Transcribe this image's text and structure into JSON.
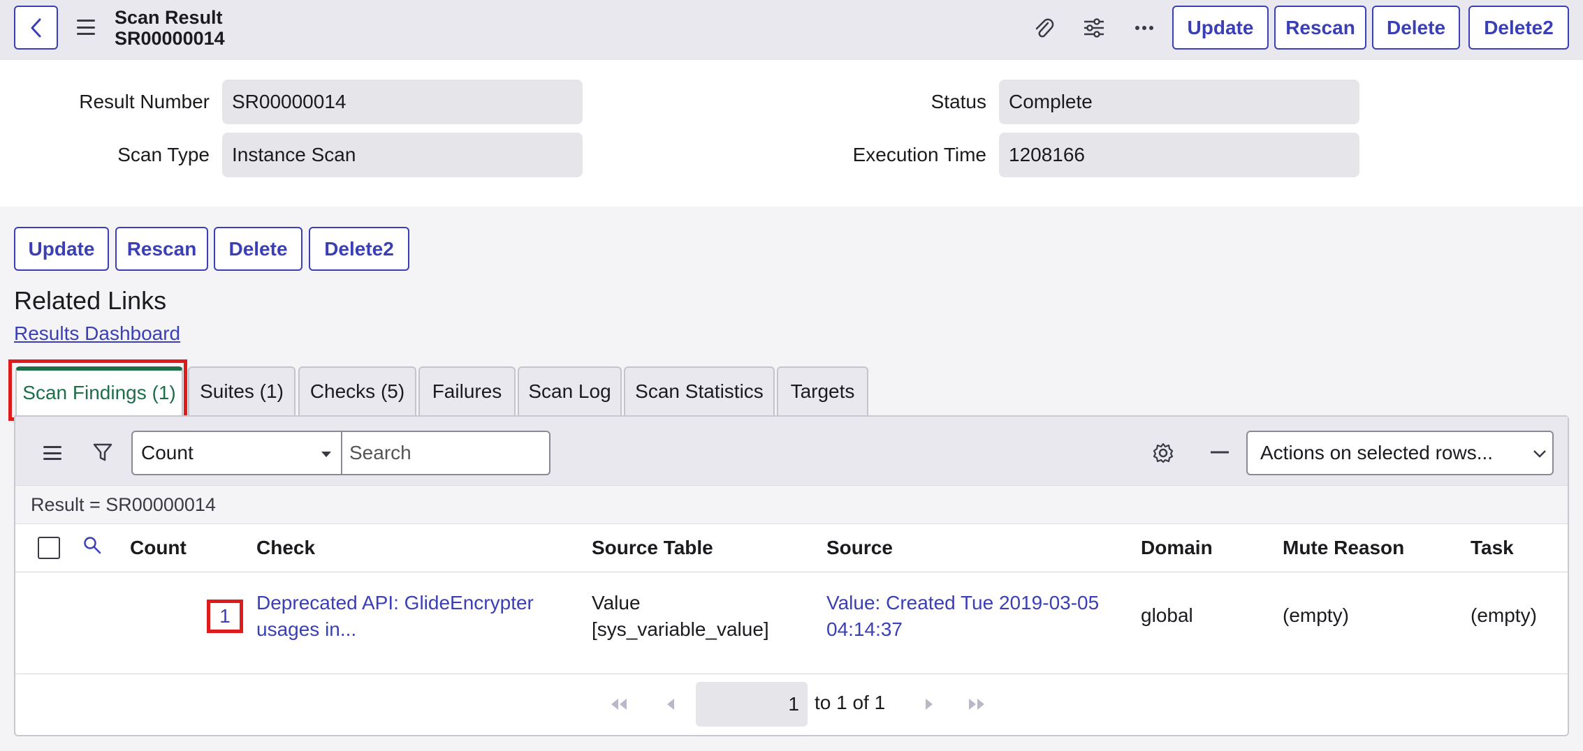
{
  "header": {
    "title_line1": "Scan Result",
    "title_line2": "SR00000014",
    "buttons": {
      "update": "Update",
      "rescan": "Rescan",
      "delete": "Delete",
      "delete2": "Delete2"
    },
    "icons": [
      "back-icon",
      "menu-icon",
      "paperclip-icon",
      "settings-sliders-icon",
      "more-icon"
    ]
  },
  "form": {
    "result_number_label": "Result Number",
    "result_number_value": "SR00000014",
    "status_label": "Status",
    "status_value": "Complete",
    "scan_type_label": "Scan Type",
    "scan_type_value": "Instance Scan",
    "execution_time_label": "Execution Time",
    "execution_time_value": "1208166"
  },
  "form_buttons": {
    "update": "Update",
    "rescan": "Rescan",
    "delete": "Delete",
    "delete2": "Delete2"
  },
  "related_links": {
    "title": "Related Links",
    "results_dashboard": "Results Dashboard"
  },
  "tabs": [
    {
      "label": "Scan Findings (1)",
      "active": true
    },
    {
      "label": "Suites (1)"
    },
    {
      "label": "Checks (5)"
    },
    {
      "label": "Failures"
    },
    {
      "label": "Scan Log"
    },
    {
      "label": "Scan Statistics"
    },
    {
      "label": "Targets"
    }
  ],
  "list": {
    "search_field": "Count",
    "search_placeholder": "Search",
    "actions_select": "Actions on selected rows...",
    "filter_breadcrumb": "Result = SR00000014",
    "columns": [
      "Count",
      "Check",
      "Source Table",
      "Source",
      "Domain",
      "Mute Reason",
      "Task"
    ],
    "rows": [
      {
        "count": "1",
        "check_line1": "Deprecated API: GlideEncrypter",
        "check_line2": "usages in...",
        "source_table_line1": "Value",
        "source_table_line2": "[sys_variable_value]",
        "source_line1": "Value: Created Tue 2019-03-05",
        "source_line2": "04:14:37",
        "domain": "global",
        "mute_reason": "(empty)",
        "task": "(empty)"
      }
    ],
    "pagination": {
      "current_page": "1",
      "range_text": "to 1 of 1"
    }
  },
  "colors": {
    "accent": "#3b3fb6",
    "active_tab": "#1e6e4a",
    "highlight": "#e01b1b"
  }
}
